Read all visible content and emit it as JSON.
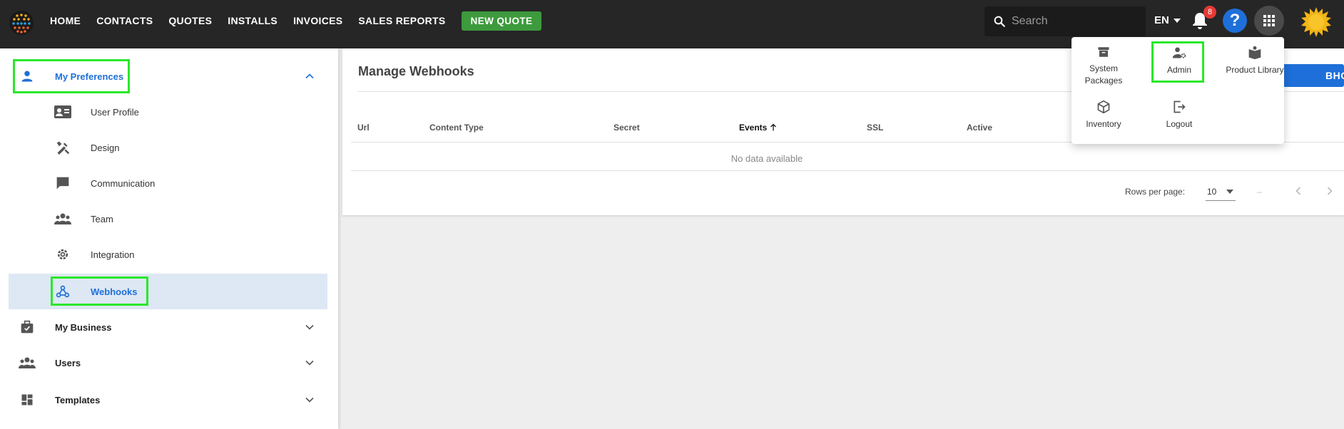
{
  "topbar": {
    "nav": [
      "HOME",
      "CONTACTS",
      "QUOTES",
      "INSTALLS",
      "INVOICES",
      "SALES REPORTS"
    ],
    "new_quote": "NEW QUOTE",
    "search_placeholder": "Search",
    "language": "EN",
    "notification_count": "8",
    "help": "?"
  },
  "sidebar": {
    "my_preferences": "My Preferences",
    "children": [
      "User Profile",
      "Design",
      "Communication",
      "Team",
      "Integration",
      "Webhooks"
    ],
    "my_business": "My Business",
    "users": "Users",
    "templates": "Templates"
  },
  "main": {
    "title": "Manage Webhooks",
    "add_button": "BHOOK",
    "columns": [
      "Url",
      "Content Type",
      "Secret",
      "Events",
      "SSL",
      "Active"
    ],
    "no_data": "No data available",
    "rows_per_page_label": "Rows per page:",
    "rows_per_page_value": "10",
    "range": "–"
  },
  "apps_menu": {
    "items": [
      "System Packages",
      "Admin",
      "Product Library",
      "Inventory",
      "Logout"
    ]
  },
  "colors": {
    "topbar": "#262626",
    "accent": "#1e6fd9",
    "new_quote": "#3d9a3d",
    "highlight": "#2ae82a",
    "active_row": "#dde8f4"
  }
}
